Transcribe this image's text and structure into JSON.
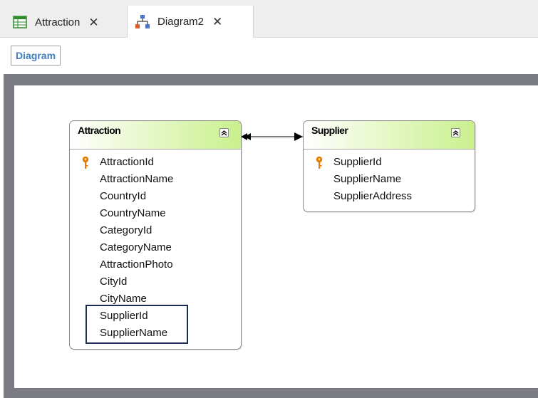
{
  "tabs": [
    {
      "label": "Attraction",
      "icon": "table-icon",
      "active": false
    },
    {
      "label": "Diagram2",
      "icon": "diagram-icon",
      "active": true
    }
  ],
  "toolbar": {
    "diagram_label": "Diagram"
  },
  "entities": [
    {
      "title": "Attraction",
      "attributes": [
        "AttractionId",
        "AttractionName",
        "CountryId",
        "CountryName",
        "CategoryId",
        "CategoryName",
        "AttractionPhoto",
        "CityId",
        "CityName",
        "SupplierId",
        "SupplierName"
      ],
      "key": "AttractionId",
      "highlighted": [
        "SupplierId",
        "SupplierName"
      ]
    },
    {
      "title": "Supplier",
      "attributes": [
        "SupplierId",
        "SupplierName",
        "SupplierAddress"
      ],
      "key": "SupplierId"
    }
  ],
  "relationship": {
    "from": "Attraction",
    "to": "Supplier",
    "ends": "many-to-one"
  },
  "colors": {
    "header_gradient_end": "#c9f08c",
    "canvas_border": "#7b7b83",
    "key_icon": "#e87a00",
    "highlight_border": "#1d2a55",
    "toolbar_label": "#3f7fc1"
  }
}
